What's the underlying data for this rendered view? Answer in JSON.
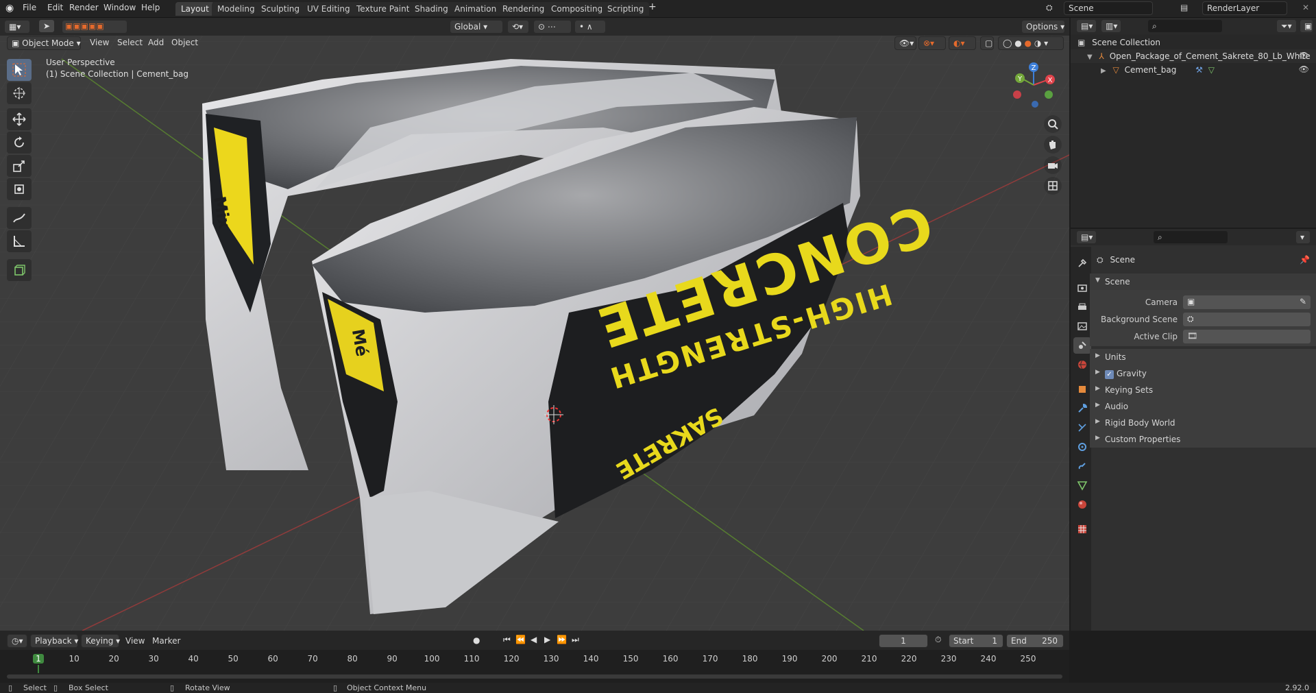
{
  "topbar": {
    "menus": [
      "File",
      "Edit",
      "Render",
      "Window",
      "Help"
    ],
    "workspaces": [
      "Layout",
      "Modeling",
      "Sculpting",
      "UV Editing",
      "Texture Paint",
      "Shading",
      "Animation",
      "Rendering",
      "Compositing",
      "Scripting"
    ],
    "active_workspace": "Layout",
    "add_tab": "+",
    "scene_name": "Scene",
    "view_layer": "RenderLayer"
  },
  "viewport_header": {
    "transform_orientation": "Global",
    "options_label": "Options",
    "mode": "Object Mode",
    "menus": [
      "View",
      "Select",
      "Add",
      "Object"
    ]
  },
  "viewport": {
    "perspective_label": "User Perspective",
    "collection_label": "(1) Scene Collection | Cement_bag",
    "bag_text": {
      "brand": "SAKRETE",
      "line1": "HIGH-STRENGTH",
      "line2": "CONCRETE",
      "side1": "Mix",
      "side2": "Mé"
    },
    "gizmo_axes": [
      "X",
      "Y",
      "Z"
    ]
  },
  "outliner": {
    "root": "Scene Collection",
    "items": [
      {
        "label": "Open_Package_of_Cement_Sakrete_80_Lb_White"
      },
      {
        "label": "Cement_bag"
      }
    ]
  },
  "properties": {
    "breadcrumb": "Scene",
    "panel_title": "Scene",
    "fields": [
      {
        "label": "Camera"
      },
      {
        "label": "Background Scene"
      },
      {
        "label": "Active Clip"
      }
    ],
    "subpanels": [
      "Units",
      "Gravity",
      "Keying Sets",
      "Audio",
      "Rigid Body World",
      "Custom Properties"
    ],
    "gravity_checked": true
  },
  "timeline": {
    "menus": [
      "Playback",
      "Keying",
      "View",
      "Marker"
    ],
    "current_frame": "1",
    "start_label": "Start",
    "start_value": "1",
    "end_label": "End",
    "end_value": "250",
    "ticks": [
      "1",
      "10",
      "20",
      "30",
      "40",
      "50",
      "60",
      "70",
      "80",
      "90",
      "100",
      "110",
      "120",
      "130",
      "140",
      "150",
      "160",
      "170",
      "180",
      "190",
      "200",
      "210",
      "220",
      "230",
      "240",
      "250"
    ]
  },
  "statusbar": {
    "items": [
      "Select",
      "Box Select",
      "Rotate View",
      "Object Context Menu"
    ],
    "version": "2.92.0"
  },
  "colors": {
    "accent": "#e56a2c",
    "active_tool": "#5a6d88",
    "axis_x": "#e0434b",
    "axis_y": "#74a83a",
    "axis_z": "#3d7fd9"
  }
}
